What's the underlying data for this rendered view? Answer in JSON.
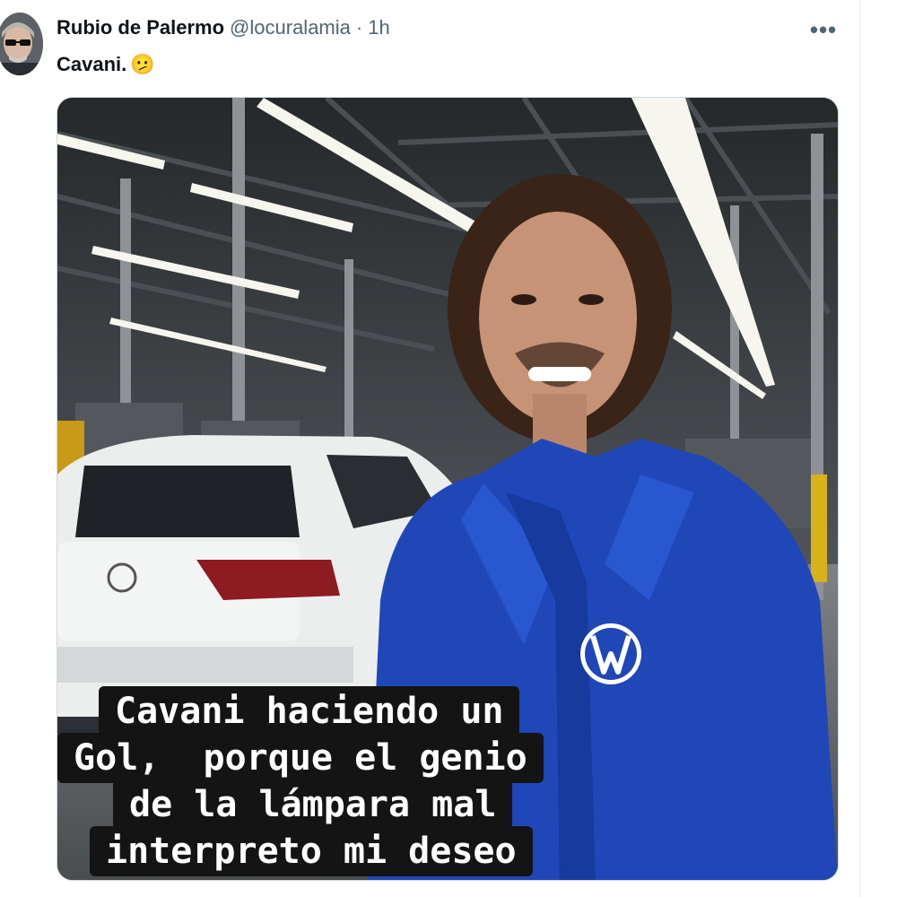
{
  "tweet": {
    "display_name": "Rubio de Palermo",
    "handle": "@locuralamia",
    "separator": "·",
    "time": "1h",
    "text": "Cavani.",
    "emoji": "🫤",
    "more_label": "•••"
  },
  "media": {
    "caption_lines": [
      "Cavani haciendo un",
      "Gol,  porque el genio",
      "de la lámpara mal",
      "interpreto mi deseo"
    ],
    "accent_colors": {
      "jacket": "#1f47b8",
      "factory": "#2f3236",
      "car": "#eceeee",
      "caption_bg": "#141414"
    }
  }
}
